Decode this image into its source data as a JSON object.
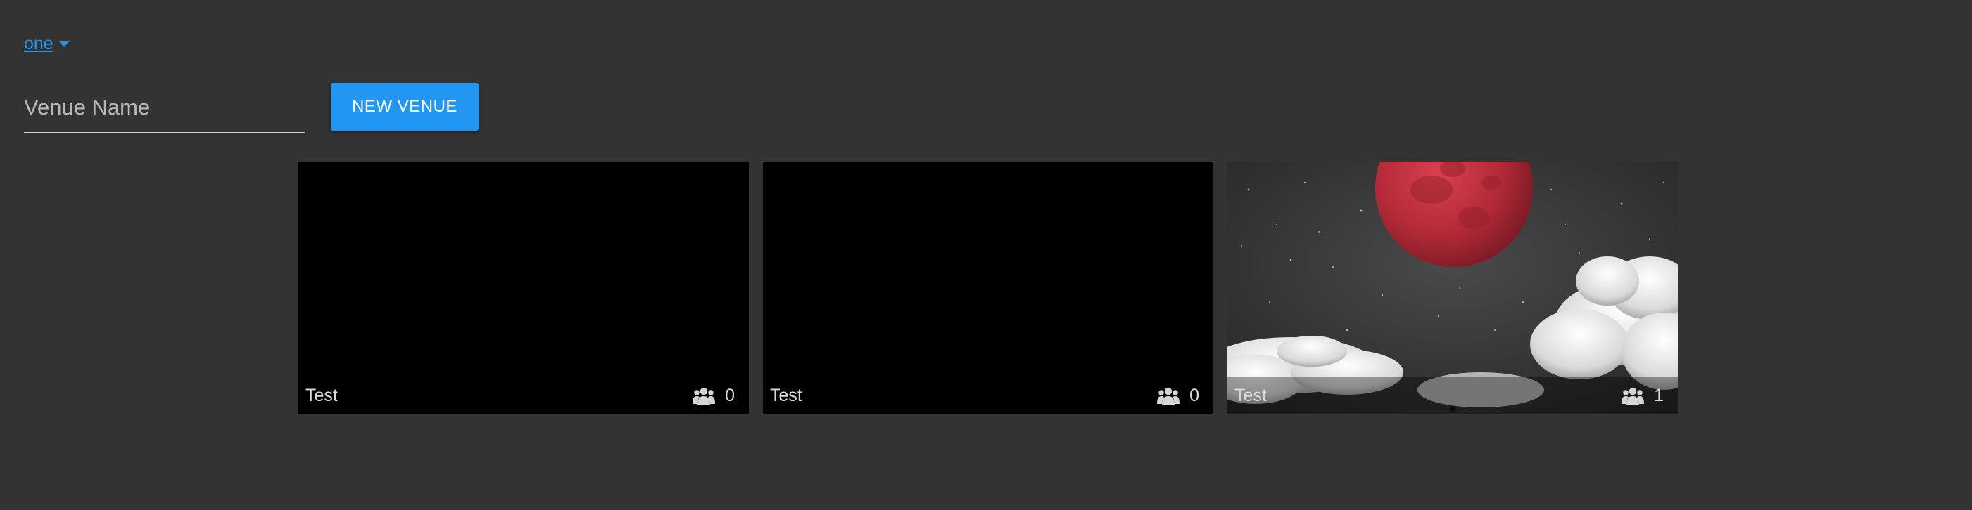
{
  "account": {
    "label": "one"
  },
  "new_venue": {
    "placeholder": "Venue Name",
    "value": "",
    "button_label": "NEW VENUE"
  },
  "colors": {
    "accent": "#2196f3",
    "background": "#333333"
  },
  "venues": [
    {
      "title": "Test",
      "count": "0",
      "icon": "users-icon",
      "image": "none"
    },
    {
      "title": "Test",
      "count": "0",
      "icon": "users-icon",
      "image": "none"
    },
    {
      "title": "Test",
      "count": "1",
      "icon": "users-icon",
      "image": "red-moon-night-sky-clouds"
    }
  ]
}
